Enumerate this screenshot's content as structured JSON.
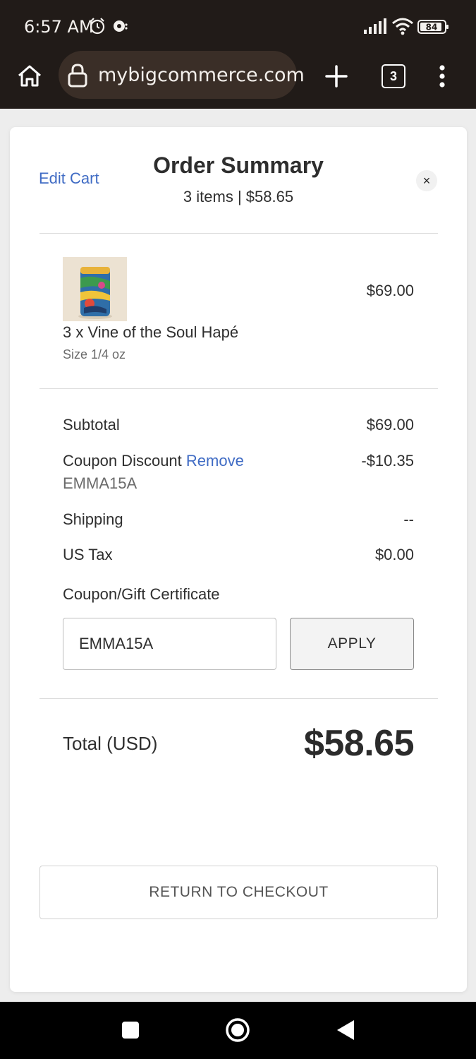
{
  "status_bar": {
    "time": "6:57 AM",
    "battery": "84",
    "icons": [
      "alarm-icon",
      "notification-icon",
      "signal-icon",
      "wifi-icon",
      "battery-icon"
    ]
  },
  "browser": {
    "url": "mybigcommerce.com",
    "tab_count": "3",
    "icons": [
      "home-icon",
      "lock-icon",
      "plus-icon",
      "tabs-icon",
      "more-vert-icon"
    ]
  },
  "order_summary": {
    "edit_cart": "Edit Cart",
    "title": "Order Summary",
    "subtitle": "3 items | $58.65",
    "close_icon": "×",
    "item": {
      "name": "3 x Vine of the Soul Hapé",
      "option": "Size 1/4 oz",
      "price": "$69.00"
    },
    "subtotal_label": "Subtotal",
    "subtotal_value": "$69.00",
    "coupon_label": "Coupon Discount",
    "coupon_remove": "Remove",
    "coupon_code": "EMMA15A",
    "coupon_value": "-$10.35",
    "shipping_label": "Shipping",
    "shipping_value": "--",
    "tax_label": "US Tax",
    "tax_value": "$0.00",
    "coupon_field_label": "Coupon/Gift Certificate",
    "coupon_input_value": "EMMA15A",
    "apply_label": "APPLY",
    "total_label": "Total (USD)",
    "total_value": "$58.65",
    "return_label": "RETURN TO CHECKOUT"
  },
  "nav_bar": {
    "icons": [
      "recents-square-icon",
      "home-circle-icon",
      "back-triangle-icon"
    ]
  },
  "colors": {
    "chrome_bg": "#211b18",
    "url_pill": "#3a2e27",
    "link": "#3f6bc4",
    "text": "#2f2f2f"
  }
}
